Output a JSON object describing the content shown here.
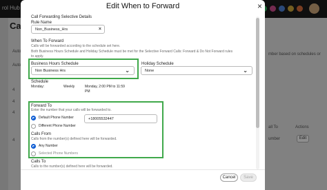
{
  "background": {
    "brand": "rol Hub",
    "page_title": "Ca",
    "text_fragments": [
      "Auto",
      "Auto",
      "4",
      "4",
      "4",
      "4",
      "mber based on schedules or",
      "all To",
      "Actions",
      "umber"
    ],
    "edit_label": "Edit"
  },
  "modal": {
    "title": "Edit When to Forward",
    "section_heading": "Call Forwarding Selective Details",
    "rule_name_label": "Rule Name",
    "rule_name_value": "Non_Business_Hrs",
    "when_heading": "When To Forward",
    "when_desc_1": "Calls will be forwarded according to the schedule set here.",
    "when_desc_2": "Both Business Hours Schedule and Holiday Schedule must be met for the Selective Forward Calls: Forward & Do Not Forward rules",
    "when_desc_3": "to apply.",
    "business_label": "Business Hours Schedule",
    "business_value": "Non Business Hrs",
    "holiday_label": "Holiday Schedule",
    "holiday_value": "None",
    "schedule_heading": "Schedule",
    "schedule_day": "Monday:",
    "schedule_freq": "Weekly",
    "schedule_time_1": "Monday, 2:00 PM to 11:59",
    "schedule_time_2": "PM",
    "forward_heading": "Forward To",
    "forward_desc": "Enter the number that your calls will be forwarded to.",
    "default_phone_label": "Default Phone Number",
    "default_phone_value": "+18005532447",
    "different_phone_label": "Different Phone Number",
    "calls_from_heading": "Calls From",
    "calls_from_desc": "Calls from the number(s) defined here will be forwarded.",
    "any_number_label": "Any Number",
    "selected_numbers_label": "Selected Phone Numbers",
    "calls_to_heading": "Calls To",
    "calls_to_desc": "Calls to the number(s) defined here will be forwarded.",
    "cancel_label": "Cancel",
    "save_label": "Save",
    "close_glyph": "×",
    "clear_glyph": "×",
    "chevron_glyph": "⌄"
  },
  "colors": {
    "highlight": "#3fa84a",
    "radio_selected": "#0b5bd3",
    "overlay": "rgba(0,0,0,0.42)"
  }
}
